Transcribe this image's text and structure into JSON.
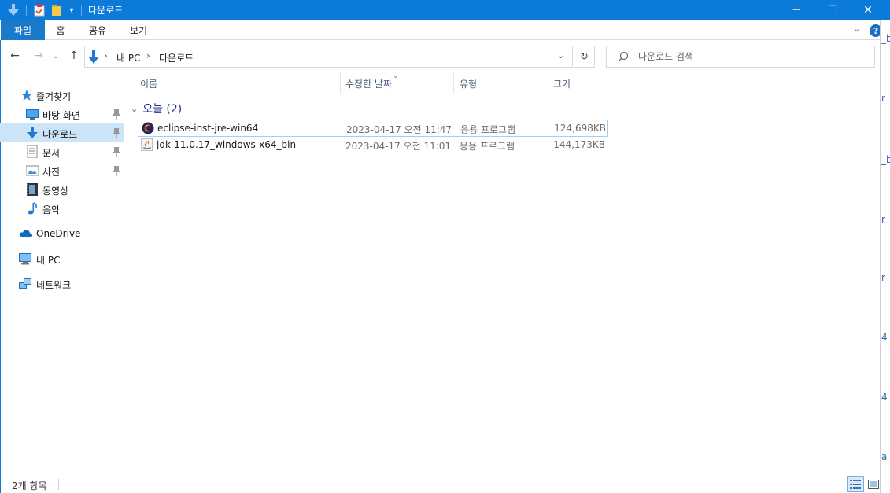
{
  "window": {
    "title": "다운로드",
    "controls": {
      "minimize": "─",
      "maximize": "☐",
      "close": "✕"
    }
  },
  "ribbon": {
    "tabs": [
      {
        "label": "파일",
        "active": true
      },
      {
        "label": "홈"
      },
      {
        "label": "공유"
      },
      {
        "label": "보기"
      }
    ],
    "help": "?",
    "expand": "⌄"
  },
  "nav": {
    "back": "←",
    "forward": "→",
    "recent": "⌄",
    "up": "↑",
    "breadcrumb": [
      "내 PC",
      "다운로드"
    ],
    "separator": "›",
    "dropdown": "⌄",
    "refresh": "↻",
    "search_placeholder": "다운로드 검색"
  },
  "sidebar": {
    "items": [
      {
        "label": "즐겨찾기",
        "icon": "star-icon"
      },
      {
        "label": "바탕 화면",
        "icon": "desktop-icon",
        "pinned": true
      },
      {
        "label": "다운로드",
        "icon": "download-icon",
        "pinned": true,
        "selected": true
      },
      {
        "label": "문서",
        "icon": "document-icon",
        "pinned": true
      },
      {
        "label": "사진",
        "icon": "picture-icon",
        "pinned": true
      },
      {
        "label": "동영상",
        "icon": "video-icon"
      },
      {
        "label": "음악",
        "icon": "music-icon"
      },
      {
        "label": "OneDrive",
        "icon": "cloud-icon"
      },
      {
        "label": "내 PC",
        "icon": "computer-icon"
      },
      {
        "label": "네트워크",
        "icon": "network-icon"
      }
    ]
  },
  "columns": [
    {
      "label": "이름"
    },
    {
      "label": "수정한 날짜"
    },
    {
      "label": "유형"
    },
    {
      "label": "크기"
    }
  ],
  "group": {
    "label": "오늘 (2)",
    "chevron": "⌄"
  },
  "files": [
    {
      "name": "eclipse-inst-jre-win64",
      "date": "2023-04-17 오전 11:47",
      "type": "응용 프로그램",
      "size": "124,698KB",
      "icon": "eclipse-icon"
    },
    {
      "name": "jdk-11.0.17_windows-x64_bin",
      "date": "2023-04-17 오전 11:01",
      "type": "응용 프로그램",
      "size": "144,173KB",
      "icon": "java-installer-icon"
    }
  ],
  "status": {
    "count": "2개 항목"
  },
  "colors": {
    "titlebar": "#0c7ad8",
    "active_tab": "#1979ca",
    "selected_item": "#cce4f7",
    "group_label": "#1e3287"
  }
}
